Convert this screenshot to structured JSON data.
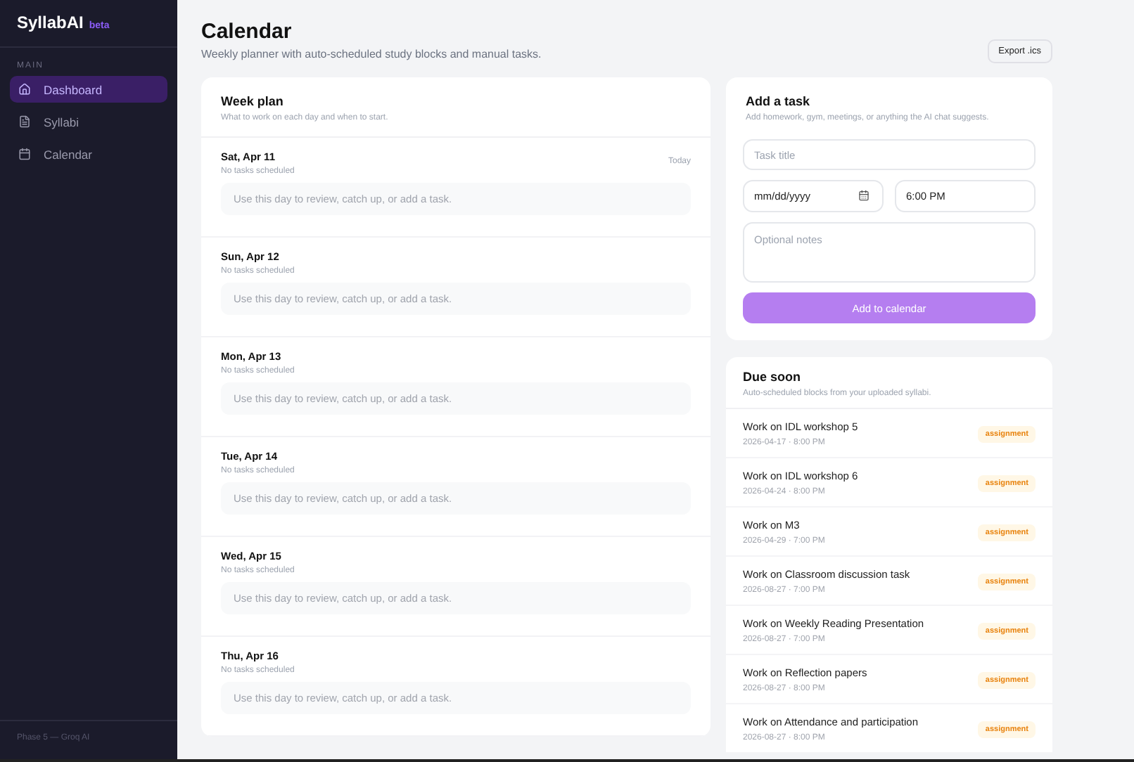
{
  "sidebar": {
    "brand": "SyllabAI",
    "badge": "beta",
    "section": "MAIN",
    "items": [
      {
        "label": "Dashboard",
        "selected": true
      },
      {
        "label": "Syllabi",
        "selected": false
      },
      {
        "label": "Calendar",
        "selected": false
      }
    ],
    "footer": "Phase 5 — Groq AI"
  },
  "header": {
    "title": "Calendar",
    "subtitle": "Weekly planner with auto-scheduled study blocks and manual tasks.",
    "export_button": "Export .ics"
  },
  "week_plan": {
    "title": "Week plan",
    "subtitle": "What to work on each day and when to start.",
    "days": [
      {
        "date": "Sat, Apr 11",
        "status": "No tasks scheduled",
        "badge": "Today",
        "empty_hint": "Use this day to review, catch up, or add a task."
      },
      {
        "date": "Sun, Apr 12",
        "status": "No tasks scheduled",
        "empty_hint": "Use this day to review, catch up, or add a task."
      },
      {
        "date": "Mon, Apr 13",
        "status": "No tasks scheduled",
        "empty_hint": "Use this day to review, catch up, or add a task."
      },
      {
        "date": "Tue, Apr 14",
        "status": "No tasks scheduled",
        "empty_hint": "Use this day to review, catch up, or add a task."
      },
      {
        "date": "Wed, Apr 15",
        "status": "No tasks scheduled",
        "empty_hint": "Use this day to review, catch up, or add a task."
      },
      {
        "date": "Thu, Apr 16",
        "status": "No tasks scheduled",
        "empty_hint": "Use this day to review, catch up, or add a task."
      }
    ]
  },
  "add_task": {
    "title": "Add a task",
    "subtitle": "Add homework, gym, meetings, or anything the AI chat suggests.",
    "title_field": {
      "placeholder": "Task title"
    },
    "date_field": {
      "placeholder": "mm/dd/yyyy"
    },
    "time_field": {
      "value": "6:00 PM"
    },
    "notes_field": {
      "placeholder": "Optional notes"
    },
    "submit_button": "Add to calendar"
  },
  "due_soon": {
    "title": "Due soon",
    "subtitle": "Auto-scheduled blocks from your uploaded syllabi.",
    "items": [
      {
        "title": "Work on IDL workshop 5",
        "when": "2026-04-17 · 8:00 PM",
        "tag": "assignment"
      },
      {
        "title": "Work on IDL workshop 6",
        "when": "2026-04-24 · 8:00 PM",
        "tag": "assignment"
      },
      {
        "title": "Work on M3",
        "when": "2026-04-29 · 7:00 PM",
        "tag": "assignment"
      },
      {
        "title": "Work on Classroom discussion task",
        "when": "2026-08-27 · 7:00 PM",
        "tag": "assignment"
      },
      {
        "title": "Work on Weekly Reading Presentation",
        "when": "2026-08-27 · 7:00 PM",
        "tag": "assignment"
      },
      {
        "title": "Work on Reflection papers",
        "when": "2026-08-27 · 8:00 PM",
        "tag": "assignment"
      },
      {
        "title": "Work on Attendance and participation",
        "when": "2026-08-27 · 8:00 PM",
        "tag": "assignment"
      }
    ]
  }
}
